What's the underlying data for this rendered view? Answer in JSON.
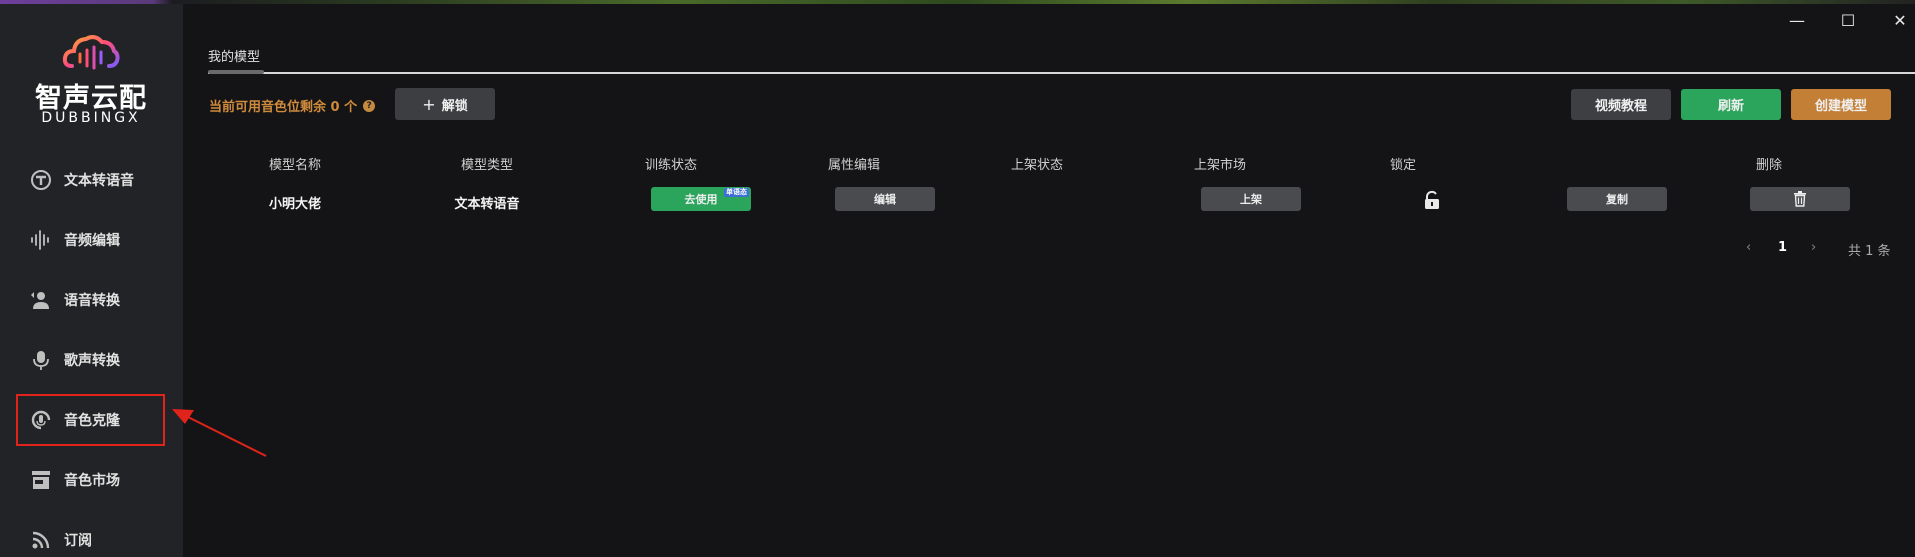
{
  "app": {
    "logo_name": "智声云配",
    "logo_sub": "DUBBINGX"
  },
  "window_controls": {
    "minimize": "—",
    "maximize": "☐",
    "close": "✕"
  },
  "sidebar": {
    "items": [
      {
        "label": "文本转语音",
        "icon": "tts-icon"
      },
      {
        "label": "音频编辑",
        "icon": "waveform-icon"
      },
      {
        "label": "语音转换",
        "icon": "voice-convert-icon"
      },
      {
        "label": "歌声转换",
        "icon": "microphone-icon"
      },
      {
        "label": "音色克隆",
        "icon": "voice-clone-icon",
        "highlighted": true
      },
      {
        "label": "音色市场",
        "icon": "store-icon"
      },
      {
        "label": "订阅",
        "icon": "rss-icon"
      }
    ]
  },
  "main": {
    "tab": "我的模型",
    "quota_text": "当前可用音色位剩余 0 个",
    "quota_help": "?",
    "unlock_label": "解锁",
    "buttons": {
      "tutorial": "视频教程",
      "refresh": "刷新",
      "create": "创建模型"
    },
    "table": {
      "headers": [
        "模型名称",
        "模型类型",
        "训练状态",
        "属性编辑",
        "上架状态",
        "上架市场",
        "锁定",
        "删除"
      ],
      "rows": [
        {
          "name": "小明大佬",
          "type": "文本转语音",
          "train_status": "去使用",
          "train_badge": "单语态",
          "edit": "编辑",
          "shelf_status": "",
          "list_market": "上架",
          "copy": "复制"
        }
      ]
    },
    "pagination": {
      "prev": "‹",
      "current": "1",
      "next": "›",
      "total": "共 1 条"
    }
  },
  "colors": {
    "accent_orange": "#c47f37",
    "accent_green": "#2ba45c",
    "highlight_red": "#e0231b",
    "sidebar_bg": "#222326",
    "main_bg": "#141416"
  }
}
